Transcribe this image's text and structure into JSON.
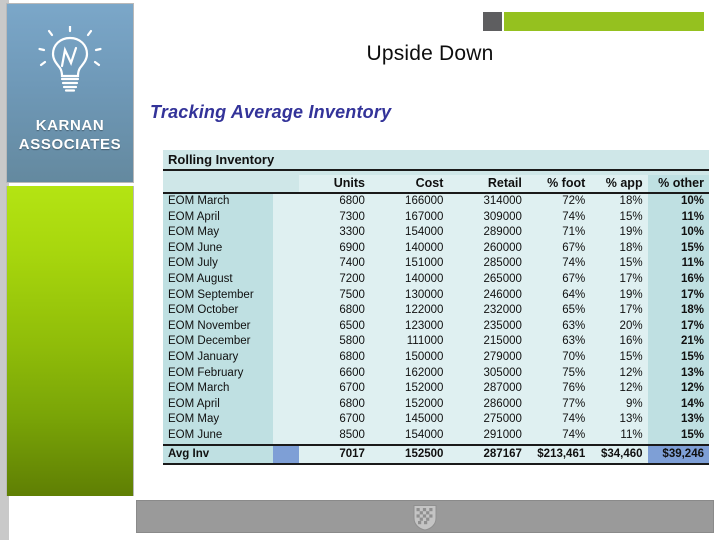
{
  "brand": {
    "logo_icon": "lightbulb-icon",
    "name_line1": "KARNAN",
    "name_line2": "ASSOCIATES",
    "panel_color": "#6f99b8",
    "accent_color": "#95c11f"
  },
  "topbar": {
    "square_color": "#5e5e60",
    "bar_color": "#95c11f"
  },
  "slide": {
    "title": "Upside Down",
    "subtitle": "Tracking Average Inventory",
    "subtitle_color": "#333399"
  },
  "footer": {
    "crest_icon": "shield-crest-icon",
    "bar_color": "#9a9a9a"
  },
  "chart_data": {
    "type": "table",
    "title": "Rolling Inventory",
    "columns": [
      "",
      "Units",
      "Cost",
      "Retail",
      "% foot",
      "% app",
      "% other"
    ],
    "rows": [
      [
        "EOM March",
        "6800",
        "166000",
        "314000",
        "72%",
        "18%",
        "10%"
      ],
      [
        "EOM April",
        "7300",
        "167000",
        "309000",
        "74%",
        "15%",
        "11%"
      ],
      [
        "EOM May",
        "3300",
        "154000",
        "289000",
        "71%",
        "19%",
        "10%"
      ],
      [
        "EOM June",
        "6900",
        "140000",
        "260000",
        "67%",
        "18%",
        "15%"
      ],
      [
        "EOM July",
        "7400",
        "151000",
        "285000",
        "74%",
        "15%",
        "11%"
      ],
      [
        "EOM August",
        "7200",
        "140000",
        "265000",
        "67%",
        "17%",
        "16%"
      ],
      [
        "EOM September",
        "7500",
        "130000",
        "246000",
        "64%",
        "19%",
        "17%"
      ],
      [
        "EOM October",
        "6800",
        "122000",
        "232000",
        "65%",
        "17%",
        "18%"
      ],
      [
        "EOM November",
        "6500",
        "123000",
        "235000",
        "63%",
        "20%",
        "17%"
      ],
      [
        "EOM December",
        "5800",
        "111000",
        "215000",
        "63%",
        "16%",
        "21%"
      ],
      [
        "EOM January",
        "6800",
        "150000",
        "279000",
        "70%",
        "15%",
        "15%"
      ],
      [
        "EOM February",
        "6600",
        "162000",
        "305000",
        "75%",
        "12%",
        "13%"
      ],
      [
        "EOM March",
        "6700",
        "152000",
        "287000",
        "76%",
        "12%",
        "12%"
      ],
      [
        "EOM April",
        "6800",
        "152000",
        "286000",
        "77%",
        "9%",
        "14%"
      ],
      [
        "EOM May",
        "6700",
        "145000",
        "275000",
        "74%",
        "13%",
        "13%"
      ],
      [
        "EOM June",
        "8500",
        "154000",
        "291000",
        "74%",
        "11%",
        "15%"
      ]
    ],
    "total_row": [
      "Avg Inv",
      "7017",
      "152500",
      "287167",
      "$213,461",
      "$34,460",
      "$39,246"
    ],
    "header_colors": {
      "sheet_bg": "#cfe7e8",
      "label_col_bg": "#bfe0e2",
      "data_bg": "#dff0f1",
      "total_bg": "#7e9fd6"
    }
  }
}
